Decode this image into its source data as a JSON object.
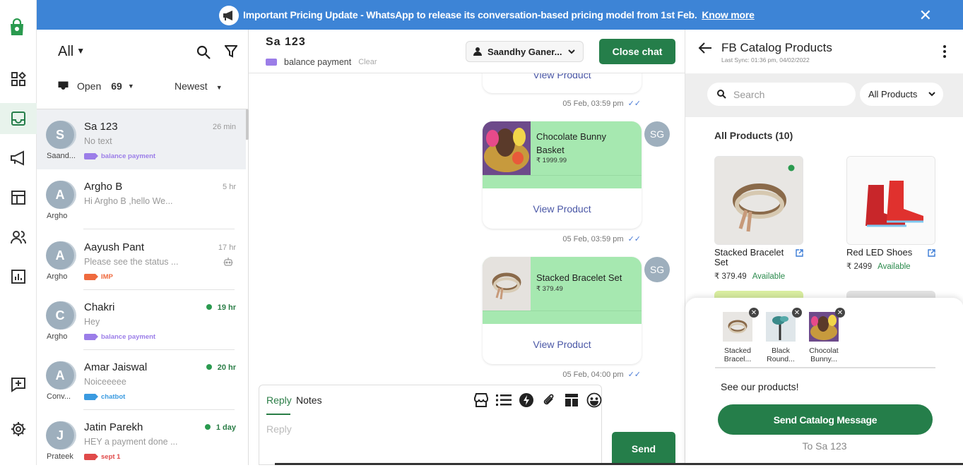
{
  "banner": {
    "text": "Important Pricing Update - WhatsApp to release its conversation-based pricing model from 1st Feb.",
    "link": "Know more"
  },
  "rail": {
    "icons": [
      "bag-logo-icon",
      "dashboard-icon",
      "inbox-icon",
      "broadcast-icon",
      "template-icon",
      "contacts-icon",
      "analytics-icon",
      "feedback-icon",
      "settings-icon"
    ],
    "accent": "#257e4a"
  },
  "list": {
    "filter_label": "All",
    "status_label": "Open",
    "status_count": "69",
    "sort_label": "Newest",
    "conversations": [
      {
        "initial": "S",
        "agent": "Saand...",
        "name": "Sa 123",
        "time": "26 min",
        "preview": "No text",
        "tag": "balance payment"
      },
      {
        "initial": "A",
        "agent": "Argho",
        "name": "Argho B",
        "time": "5 hr",
        "preview": "Hi Argho B ,hello We...",
        "tag": ""
      },
      {
        "initial": "A",
        "agent": "Argho",
        "name": "Aayush Pant",
        "time": "17 hr",
        "preview": "Please see the status ...",
        "tag": "IMP"
      },
      {
        "initial": "C",
        "agent": "Argho",
        "name": "Chakri",
        "time": "19 hr",
        "preview": "Hey",
        "tag": "balance payment"
      },
      {
        "initial": "A",
        "agent": "Conv...",
        "name": "Amar Jaiswal",
        "time": "20 hr",
        "preview": "Noiceeeee",
        "tag": "chatbot"
      },
      {
        "initial": "J",
        "agent": "Prateek",
        "name": "Jatin Parekh",
        "time": "1 day",
        "preview": "HEY a payment done ...",
        "tag": "sept 1"
      }
    ]
  },
  "chat": {
    "contact_name": "Sa 123",
    "tag": "balance payment",
    "clear_label": "Clear",
    "assignee": "Saandhy Ganer...",
    "close_label": "Close chat",
    "messages": [
      {
        "view_label": "View Product",
        "time": "05 Feb, 03:59 pm"
      },
      {
        "title": "Chocolate Bunny Basket",
        "price": "₹ 1999.99",
        "view_label": "View Product",
        "time": "05 Feb, 03:59 pm",
        "sender": "SG"
      },
      {
        "title": "Stacked Bracelet Set",
        "price": "₹ 379.49",
        "view_label": "View Product",
        "time": "05 Feb, 04:00 pm",
        "sender": "SG"
      }
    ],
    "composer": {
      "reply_tab": "Reply",
      "notes_tab": "Notes",
      "placeholder": "Reply",
      "send_label": "Send"
    }
  },
  "catalog": {
    "title": "FB Catalog Products",
    "last_sync": "Last Sync: 01:36 pm, 04/02/2022",
    "search_placeholder": "Search",
    "filter_label": "All Products",
    "section_title": "All Products (10)",
    "products": [
      {
        "name": "Stacked Bracelet Set",
        "price": "₹ 379.49",
        "status": "Available"
      },
      {
        "name": "Red LED Shoes",
        "price": "₹ 2499",
        "status": "Available"
      }
    ],
    "selected": [
      {
        "label": "Stacked Bracel..."
      },
      {
        "label": "Black Round..."
      },
      {
        "label": "Chocolat Bunny..."
      }
    ],
    "message": "See our products!",
    "send_label": "Send Catalog Message",
    "recipient": "To Sa 123"
  }
}
